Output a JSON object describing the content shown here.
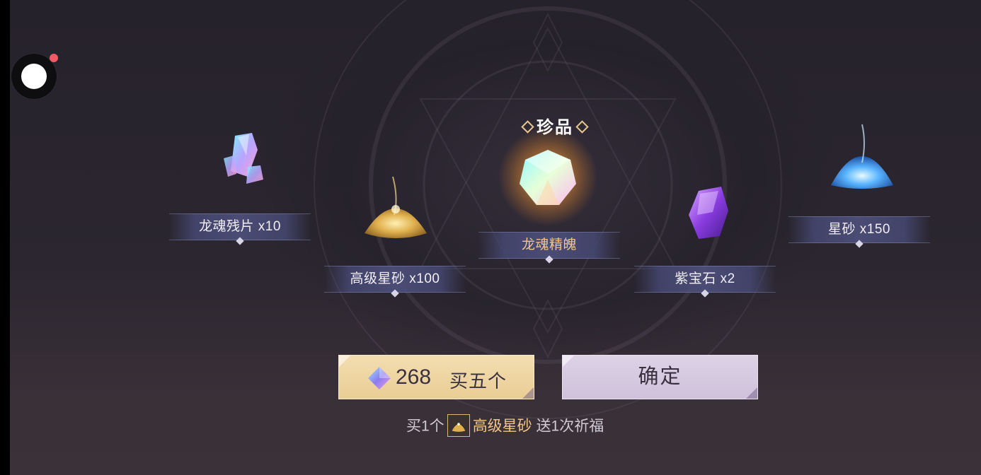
{
  "recorder": {
    "icon": "record-icon",
    "badge_color": "#ef5a64"
  },
  "treasure_label": "珍品",
  "rewards": [
    {
      "name": "龙魂残片 x10",
      "icon": "crystal-shards-icon"
    },
    {
      "name": "高级星砂 x100",
      "icon": "gold-sand-icon"
    },
    {
      "name": "龙魂精魄",
      "icon": "dragon-soul-gem-icon",
      "featured": true
    },
    {
      "name": "紫宝石 x2",
      "icon": "purple-gem-icon"
    },
    {
      "name": "星砂 x150",
      "icon": "blue-sand-icon"
    }
  ],
  "buy_button": {
    "price": "268",
    "label": "买五个",
    "icon": "diamond-currency-icon"
  },
  "confirm_button": {
    "label": "确定"
  },
  "bonus": {
    "prefix": "买1个",
    "item": "高级星砂",
    "suffix": "送1次祈福",
    "icon": "gold-sand-icon"
  },
  "colors": {
    "accent_gold": "#f3c58a",
    "buy_bg": "#f3ddb0",
    "confirm_bg": "#ddd2e6",
    "bg": "#26222c"
  }
}
